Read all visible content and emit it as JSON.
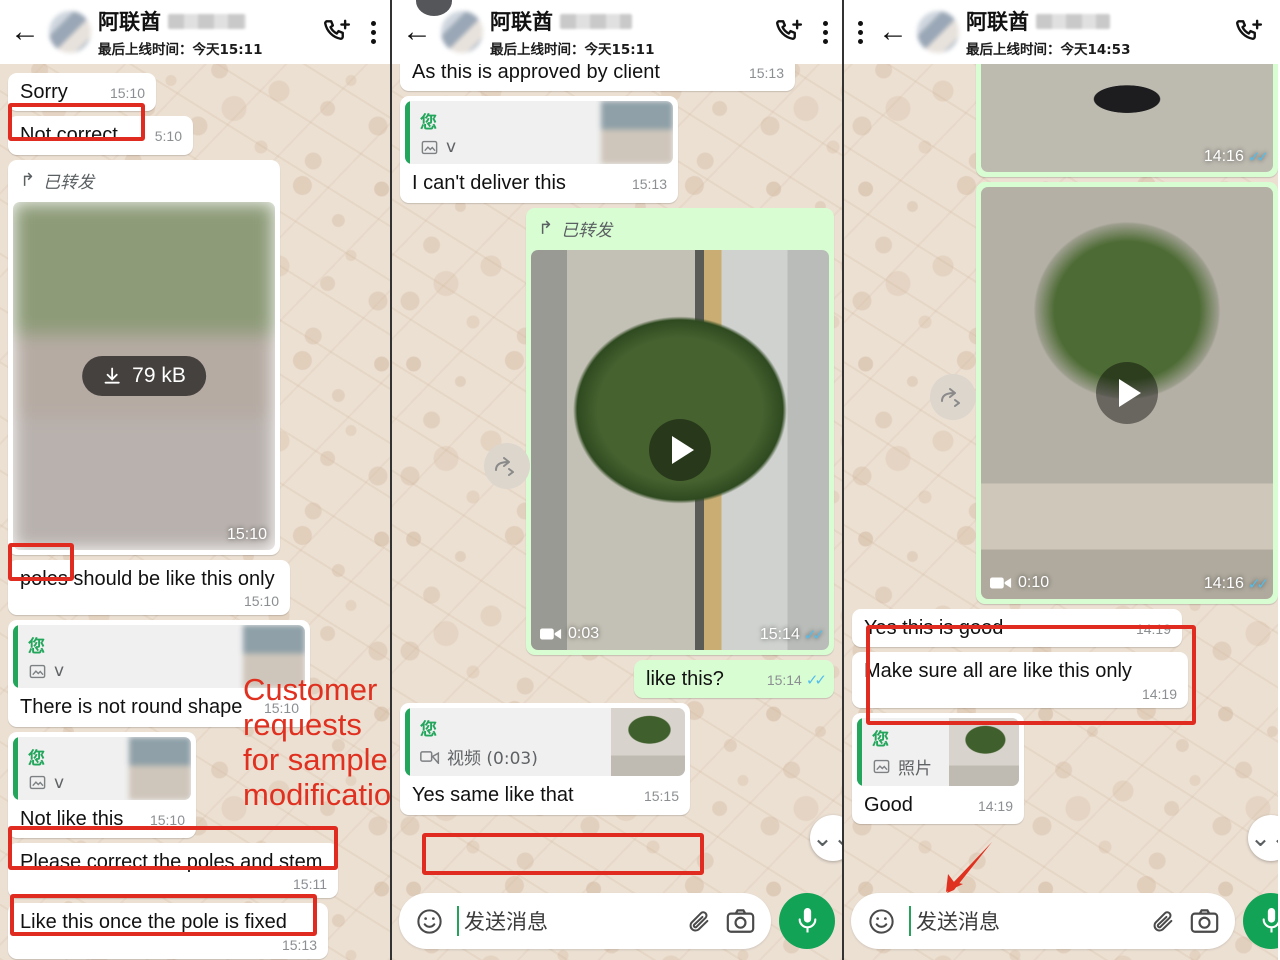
{
  "app": "WhatsApp",
  "panels": [
    {
      "id": "panel-1",
      "header": {
        "name": "阿联酋",
        "status": "最后上线时间：今天15:11",
        "redacted": true
      },
      "messages": [
        {
          "kind": "text",
          "dir": "in",
          "text": "Sorry",
          "time": "15:10"
        },
        {
          "kind": "text",
          "dir": "in",
          "text": "Not correct",
          "time": "5:10",
          "highlight": true
        },
        {
          "kind": "media",
          "dir": "in",
          "forwarded_label": "已转发",
          "download_size": "79 kB",
          "time": "15:10"
        },
        {
          "kind": "text",
          "dir": "in",
          "text": "poles should be like this only",
          "time": "15:10",
          "highlight_word": "poles"
        },
        {
          "kind": "reply",
          "dir": "in",
          "quote_name": "您",
          "quote_kind": "v",
          "text": "There is not round shape",
          "time": "15:10"
        },
        {
          "kind": "reply",
          "dir": "in",
          "quote_name": "您",
          "quote_kind": "v",
          "text": "Not like this",
          "time": "15:10"
        },
        {
          "kind": "text",
          "dir": "in",
          "text": "Please correct the poles and stem",
          "time": "15:11",
          "highlight": true
        },
        {
          "kind": "text",
          "dir": "in",
          "text": "Like this once the pole is fixed",
          "time": "15:13",
          "highlight": true
        }
      ],
      "composer": {
        "placeholder": "发送消息",
        "emoji": "emoji-icon",
        "attach": "paperclip-icon",
        "camera": "camera-icon",
        "mic": "microphone-icon"
      }
    },
    {
      "id": "panel-2",
      "header": {
        "name": "阿联酋",
        "status": "最后上线时间：今天15:11",
        "redacted": true
      },
      "messages": [
        {
          "kind": "text",
          "dir": "in",
          "text": "As this is approved by client",
          "time": "15:13",
          "clipped": true
        },
        {
          "kind": "reply",
          "dir": "in",
          "quote_name": "您",
          "quote_kind": "v",
          "text": "I can't deliver this",
          "time": "15:13"
        },
        {
          "kind": "media",
          "dir": "out",
          "forwarded_label": "已转发",
          "duration": "0:03",
          "time": "15:14",
          "ticks": "read"
        },
        {
          "kind": "text",
          "dir": "out",
          "text": "like this?",
          "time": "15:14",
          "ticks": "read"
        },
        {
          "kind": "reply",
          "dir": "in",
          "quote_name": "您",
          "quote_kind": "视频 (0:03)",
          "text": "Yes same like that",
          "time": "15:15",
          "highlight": true
        }
      ],
      "composer": {
        "placeholder": "发送消息",
        "emoji": "emoji-icon",
        "attach": "paperclip-icon",
        "camera": "camera-icon",
        "mic": "microphone-icon"
      }
    },
    {
      "id": "panel-3",
      "header": {
        "name": "阿联酋",
        "status": "最后上线时间：今天14:53",
        "redacted": true
      },
      "messages": [
        {
          "kind": "media",
          "dir": "out",
          "time": "14:16",
          "ticks": "read"
        },
        {
          "kind": "media",
          "dir": "out",
          "duration": "0:10",
          "time": "14:16",
          "ticks": "read"
        },
        {
          "kind": "text",
          "dir": "in",
          "text": "Yes this is good",
          "time": "14:19",
          "highlight": true
        },
        {
          "kind": "text",
          "dir": "in",
          "text": "Make sure all are like this only",
          "time": "14:19",
          "highlight": true
        },
        {
          "kind": "reply",
          "dir": "in",
          "quote_name": "您",
          "quote_kind": "照片",
          "text": "Good",
          "time": "14:19",
          "arrow": true
        }
      ],
      "composer": {
        "placeholder": "发送消息",
        "emoji": "emoji-icon",
        "attach": "paperclip-icon",
        "camera": "camera-icon",
        "mic": "microphone-icon"
      }
    }
  ],
  "annotation": {
    "text": "Customer requests for sample modificatio",
    "color": "#e0301f",
    "box_color": "#e02b20"
  }
}
